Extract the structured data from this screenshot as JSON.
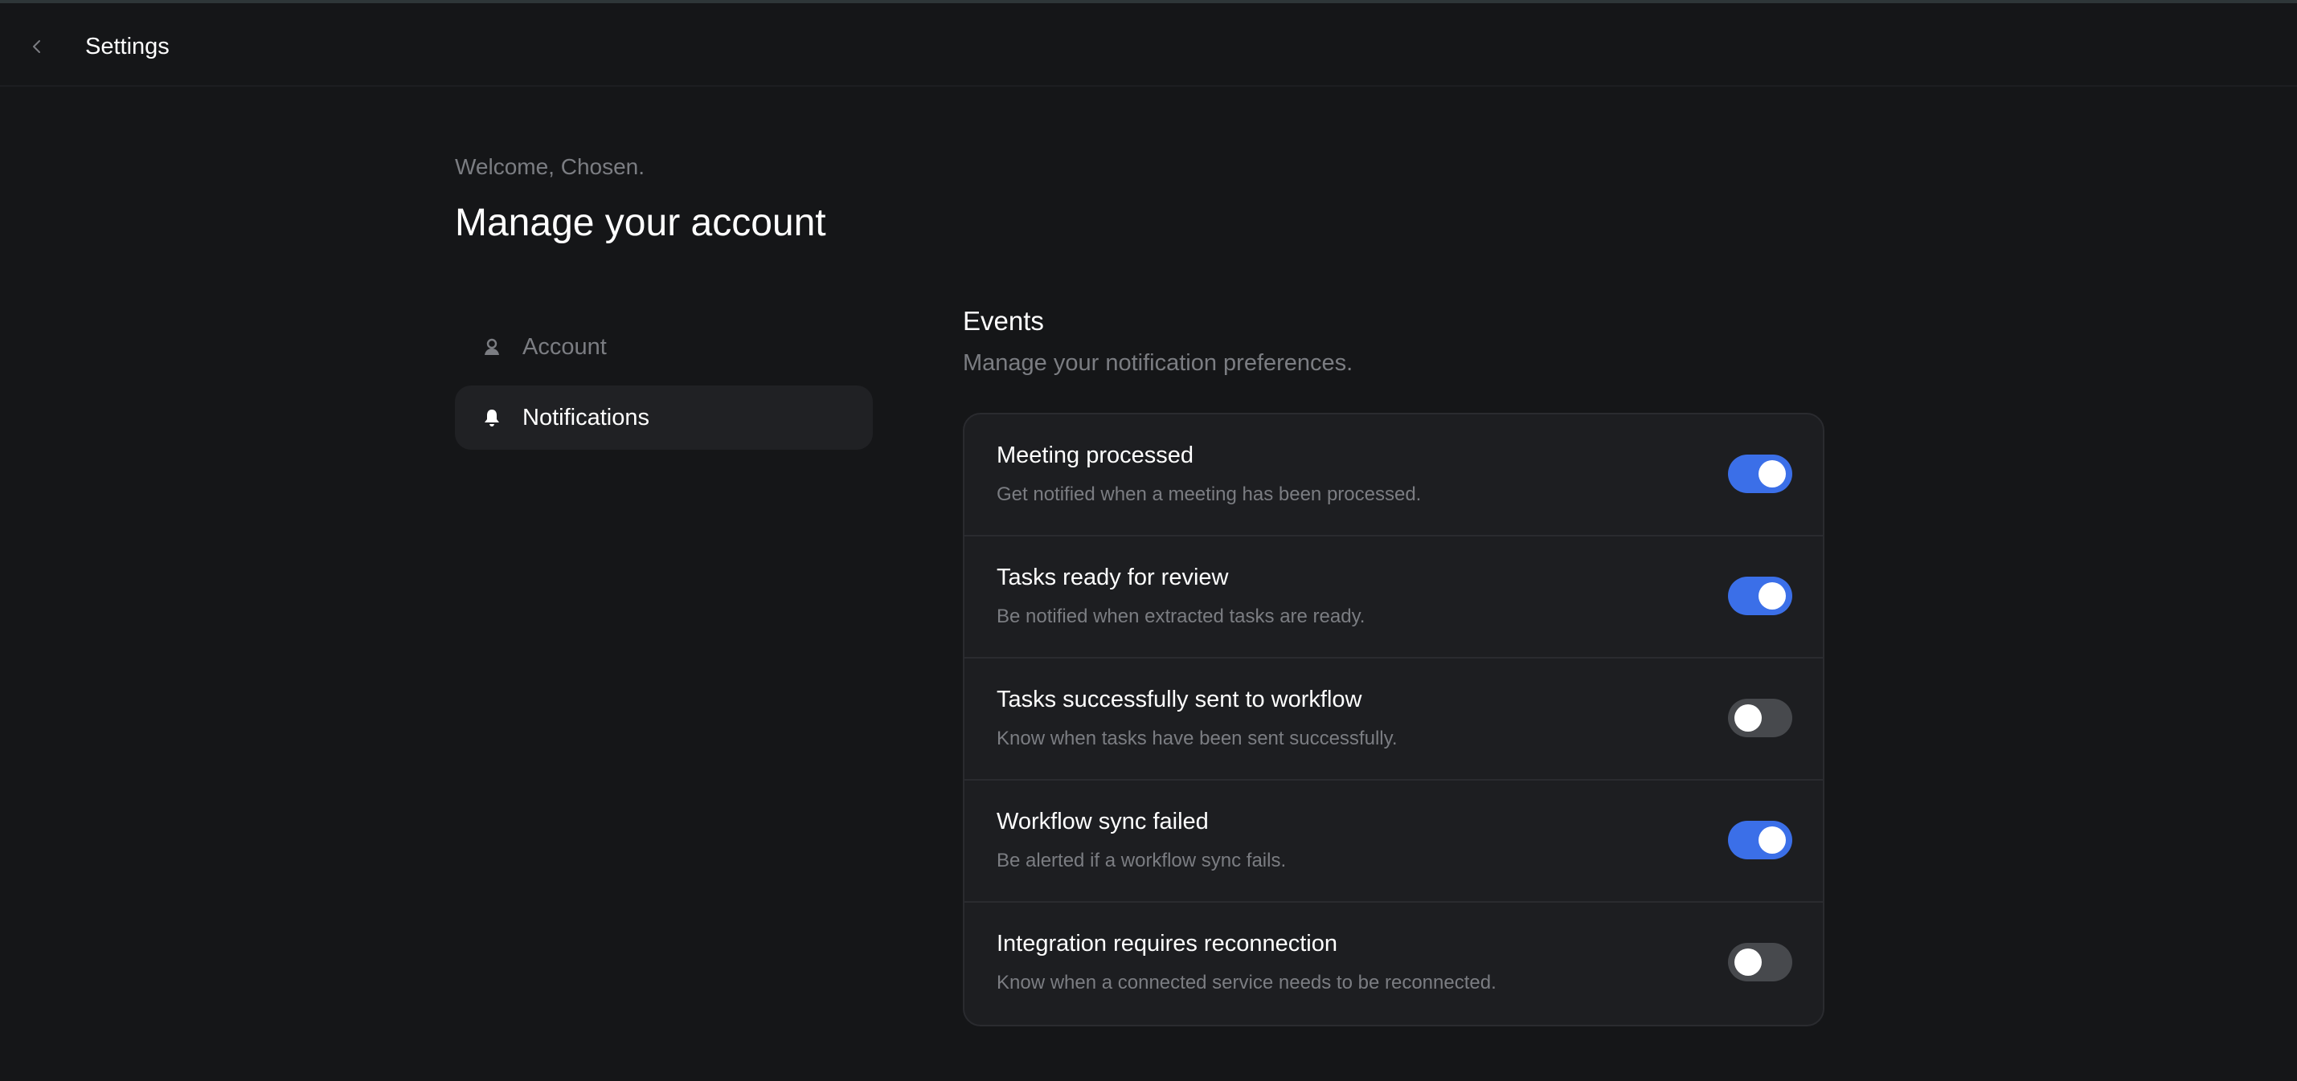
{
  "header": {
    "title": "Settings"
  },
  "page": {
    "welcome": "Welcome, Chosen.",
    "title": "Manage your account"
  },
  "nav": {
    "items": [
      {
        "label": "Account",
        "icon": "user-icon",
        "active": false
      },
      {
        "label": "Notifications",
        "icon": "bell-icon",
        "active": true
      }
    ]
  },
  "section": {
    "title": "Events",
    "description": "Manage your notification preferences."
  },
  "events": [
    {
      "title": "Meeting processed",
      "description": "Get notified when a meeting has been processed.",
      "enabled": true
    },
    {
      "title": "Tasks ready for review",
      "description": "Be notified when extracted tasks are ready.",
      "enabled": true
    },
    {
      "title": "Tasks successfully sent to workflow",
      "description": "Know when tasks have been sent successfully.",
      "enabled": false
    },
    {
      "title": "Workflow sync failed",
      "description": "Be alerted if a workflow sync fails.",
      "enabled": true
    },
    {
      "title": "Integration requires reconnection",
      "description": "Know when a connected service needs to be reconnected.",
      "enabled": false
    }
  ],
  "colors": {
    "background": "#151618",
    "card": "#1d1e21",
    "toggle_on": "#3b6fe8",
    "toggle_off": "#47494d",
    "muted_text": "#7b7d82"
  }
}
